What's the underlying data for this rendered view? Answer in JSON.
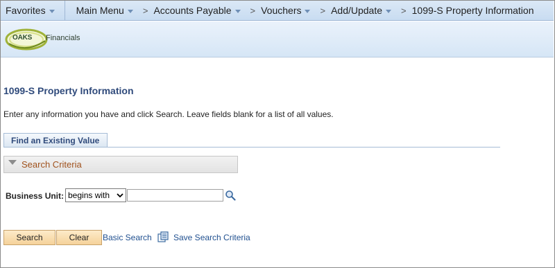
{
  "nav": {
    "favorites": "Favorites",
    "main_menu": "Main Menu",
    "separator": ">",
    "breadcrumbs": [
      "Accounts Payable",
      "Vouchers",
      "Add/Update",
      "1099-S Property Information"
    ]
  },
  "banner": {
    "logo_text": "OAKS",
    "product_text": "Financials"
  },
  "page": {
    "title": "1099-S Property Information",
    "instructions": "Enter any information you have and click Search. Leave fields blank for a list of all values."
  },
  "tabs": {
    "find_existing": "Find an Existing Value"
  },
  "criteria": {
    "header": "Search Criteria",
    "business_unit_label": "Business Unit:",
    "operator_value": "begins with",
    "business_unit_value": ""
  },
  "actions": {
    "search_label": "Search",
    "clear_label": "Clear",
    "basic_search_label": "Basic Search",
    "save_criteria_label": "Save Search Criteria"
  },
  "colors": {
    "title": "#2f4a7b",
    "criteria_header": "#a0521d",
    "link": "#1f4f8f",
    "button": "#f5d29a"
  }
}
